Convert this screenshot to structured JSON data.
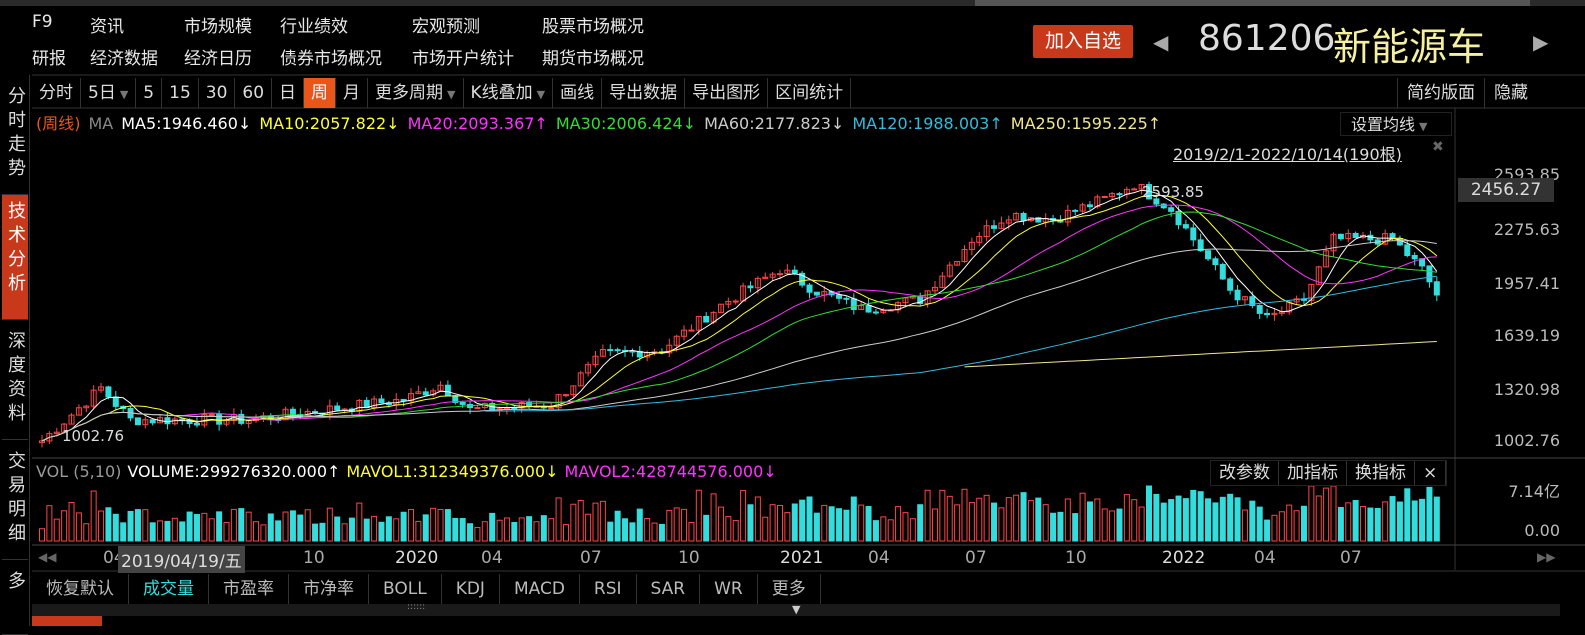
{
  "menu": {
    "row1": [
      "F9",
      "资讯",
      "市场规模",
      "行业绩效",
      "宏观预测",
      "股票市场概况"
    ],
    "row2": [
      "研报",
      "经济数据",
      "经济日历",
      "债券市场概况",
      "市场开户统计",
      "期货市场概况"
    ]
  },
  "header": {
    "add_watch": "加入自选",
    "code": "861206",
    "name": "新能源车"
  },
  "sidebar": [
    "分时走势",
    "技术分析",
    "深度资料",
    "交易明细",
    "多"
  ],
  "toolbar": [
    "分时",
    "5日",
    "5",
    "15",
    "30",
    "60",
    "日",
    "周",
    "月",
    "更多周期",
    "K线叠加",
    "画线",
    "导出数据",
    "导出图形",
    "区间统计"
  ],
  "toolbar_active": "周",
  "toolbar_right": [
    "简约版面",
    "隐藏"
  ],
  "ma_legend": [
    {
      "text": "(周线)",
      "color": "#e8561a"
    },
    {
      "text": "MA",
      "color": "#888888"
    },
    {
      "text": "MA5:1946.460↓",
      "color": "#ffffff"
    },
    {
      "text": "MA10:2057.822↓",
      "color": "#ffff33"
    },
    {
      "text": "MA20:2093.367↑",
      "color": "#ff33ff"
    },
    {
      "text": "MA30:2006.424↓",
      "color": "#33dd33"
    },
    {
      "text": "MA60:2177.823↓",
      "color": "#cccccc"
    },
    {
      "text": "MA120:1988.003↑",
      "color": "#33bbdd"
    },
    {
      "text": "MA250:1595.225↑",
      "color": "#f0e68c"
    }
  ],
  "set_ma": "设置均线",
  "range": "2019/2/1-2022/10/14(190根)",
  "price_axis": [
    "2593.85",
    "2275.63",
    "1957.41",
    "1639.19",
    "1320.98",
    "1002.76"
  ],
  "current_price": "2456.27",
  "high_label": "2593.85",
  "low_label": "1002.76",
  "vol_legend": [
    {
      "text": "VOL (5,10)",
      "color": "#999999"
    },
    {
      "text": "VOLUME:299276320.000↑",
      "color": "#ffffff"
    },
    {
      "text": "MAVOL1:312349376.000↓",
      "color": "#ffff33"
    },
    {
      "text": "MAVOL2:428744576.000↓",
      "color": "#ff33ff"
    }
  ],
  "vol_tools": [
    "改参数",
    "加指标",
    "换指标",
    "×"
  ],
  "vol_axis": [
    "7.14亿",
    "0.00"
  ],
  "time_labels": [
    "04",
    "10",
    "2020",
    "04",
    "07",
    "10",
    "2021",
    "04",
    "07",
    "10",
    "2022",
    "04",
    "07"
  ],
  "date_tip": "2019/04/19/五",
  "indicator_tabs": [
    "恢复默认",
    "成交量",
    "市盈率",
    "市净率",
    "BOLL",
    "KDJ",
    "MACD",
    "RSI",
    "SAR",
    "WR",
    "更多"
  ],
  "indicator_active": "成交量",
  "chart_data": {
    "type": "candlestick",
    "bars": 190,
    "ylim": [
      1002.76,
      2593.85
    ],
    "colors": {
      "up": "#ff4444",
      "down": "#33dddd"
    },
    "close_anchors": [
      [
        0,
        1003
      ],
      [
        8,
        1320
      ],
      [
        12,
        1130
      ],
      [
        28,
        1130
      ],
      [
        49,
        1250
      ],
      [
        54,
        1340
      ],
      [
        58,
        1190
      ],
      [
        69,
        1220
      ],
      [
        76,
        1520
      ],
      [
        84,
        1550
      ],
      [
        92,
        1815
      ],
      [
        100,
        2030
      ],
      [
        105,
        1900
      ],
      [
        111,
        1790
      ],
      [
        119,
        1850
      ],
      [
        126,
        2210
      ],
      [
        131,
        2360
      ],
      [
        137,
        2330
      ],
      [
        144,
        2450
      ],
      [
        148,
        2540
      ],
      [
        153,
        2390
      ],
      [
        157,
        2150
      ],
      [
        161,
        1910
      ],
      [
        166,
        1730
      ],
      [
        171,
        1850
      ],
      [
        175,
        2210
      ],
      [
        183,
        2210
      ],
      [
        187,
        2030
      ],
      [
        189,
        1880
      ]
    ],
    "vol_max": 714000000
  }
}
